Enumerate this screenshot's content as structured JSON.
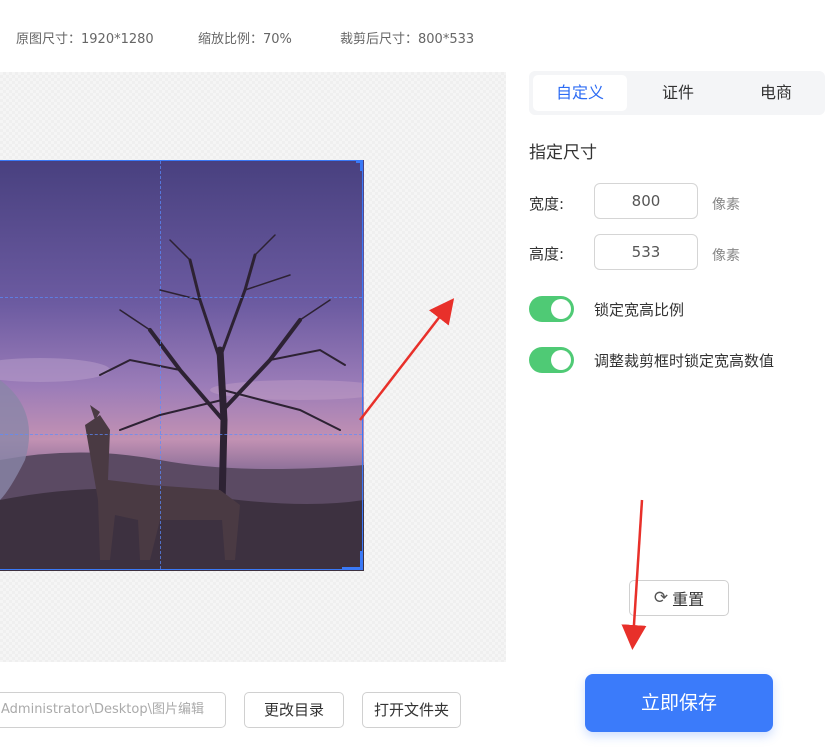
{
  "info": {
    "original_size": "原图尺寸：1920*1280",
    "zoom": "缩放比例：70%",
    "cropped_size": "裁剪后尺寸：800*533"
  },
  "tabs": [
    "自定义",
    "证件",
    "电商"
  ],
  "active_tab": "自定义",
  "panel": {
    "section_title": "指定尺寸",
    "width_label": "宽度:",
    "width_value": "800",
    "height_label": "高度:",
    "height_value": "533",
    "unit": "像素",
    "toggle_lock_ratio": "锁定宽高比例",
    "toggle_lock_values": "调整裁剪框时锁定宽高数值",
    "reset_label": "重置"
  },
  "bottom": {
    "path_value": "Administrator\\Desktop\\图片编辑",
    "change_dir_label": "更改目录",
    "open_folder_label": "打开文件夹",
    "save_label": "立即保存"
  },
  "colors": {
    "accent": "#3b7bfa",
    "toggle_on": "#4fca75",
    "arrow": "#e8302a"
  }
}
